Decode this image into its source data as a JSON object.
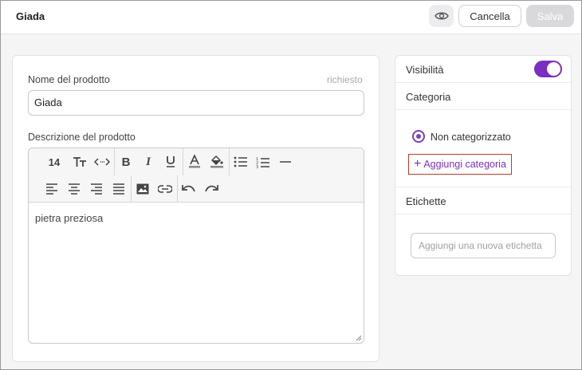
{
  "header": {
    "title": "Giada",
    "preview_icon": "eye-icon",
    "cancel_label": "Cancella",
    "save_label": "Salva"
  },
  "product": {
    "name_label": "Nome del prodotto",
    "name_hint": "richiesto",
    "name_value": "Giada",
    "description_label": "Descrizione del prodotto",
    "description_value": "pietra preziosa",
    "font_size": "14"
  },
  "toolbar_icons": [
    "font-size-icon",
    "text-case-icon",
    "code-icon",
    "bold-icon",
    "italic-icon",
    "underline-icon",
    "font-color-icon",
    "fill-color-icon",
    "bullet-list-icon",
    "numbered-list-icon",
    "horizontal-rule-icon",
    "align-left-icon",
    "align-center-icon",
    "align-right-icon",
    "align-justify-icon",
    "image-icon",
    "link-icon",
    "undo-icon",
    "redo-icon"
  ],
  "sidebar": {
    "visibility_label": "Visibilità",
    "visibility_on": true,
    "category_label": "Categoria",
    "category_option": "Non categorizzato",
    "add_category_label": "Aggiungi categoria",
    "tags_label": "Etichette",
    "tags_placeholder": "Aggiungi una nuova etichetta"
  },
  "colors": {
    "accent": "#7a2fc0",
    "highlight_border": "#c0392b"
  }
}
